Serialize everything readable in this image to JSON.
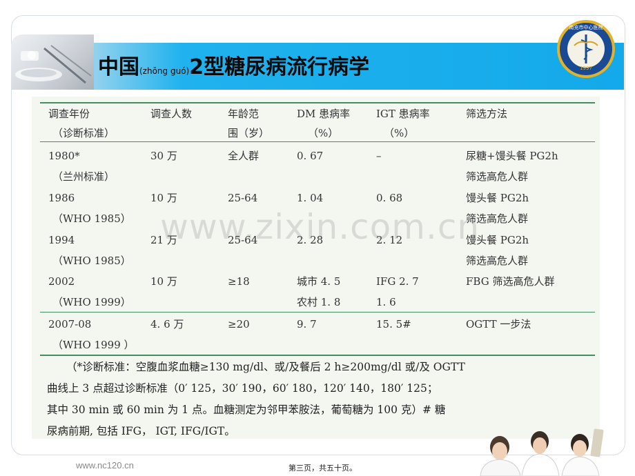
{
  "slide": {
    "title_main": "中国",
    "title_pinyin": "(zhōng guó)",
    "title_rest": "2型糖尿病流行病学"
  },
  "table": {
    "headers": [
      [
        "调查年份",
        "（诊断标准）"
      ],
      [
        "调查人数"
      ],
      [
        "年龄范",
        "围（岁）"
      ],
      [
        "DM 患病率",
        "（%）"
      ],
      [
        "IGT 患病率",
        "（%）"
      ],
      [
        "筛选方法"
      ]
    ],
    "rows": [
      {
        "year": [
          "1980*",
          "（兰州标准）"
        ],
        "people": "30 万",
        "age": "全人群",
        "dm": [
          "0. 67"
        ],
        "igt": [
          "–"
        ],
        "method": [
          "尿糖+馒头餐 PG2h",
          "筛选高危人群"
        ]
      },
      {
        "year": [
          "1986",
          "（WHO 1985）"
        ],
        "people": "10 万",
        "age": "25-64",
        "dm": [
          "1. 04"
        ],
        "igt": [
          "0. 68"
        ],
        "method": [
          "馒头餐 PG2h",
          "筛选高危人群"
        ]
      },
      {
        "year": [
          "1994",
          "（WHO 1985）"
        ],
        "people": "21 万",
        "age": "25-64",
        "dm": [
          "2. 28"
        ],
        "igt": [
          "2. 12"
        ],
        "method": [
          "馒头餐 PG2h",
          "筛选高危人群"
        ]
      },
      {
        "year": [
          "2002",
          "（WHO 1999）"
        ],
        "people": "10 万",
        "age": "≥18",
        "dm": [
          "城市 4. 5",
          "农村 1. 8"
        ],
        "igt": [
          "IFG  2. 7",
          "1. 6"
        ],
        "method": [
          "FBG 筛选高危人群"
        ]
      },
      {
        "year": [
          "2007-08",
          "（WHO 1999 ）"
        ],
        "people": "4. 6  万",
        "age": "≥20",
        "dm": [
          "9. 7"
        ],
        "igt": [
          "15. 5#"
        ],
        "method": [
          "OGTT  一步法"
        ]
      }
    ],
    "note_lines": [
      "（*诊断标准：空腹血浆血糖≥130 mg/dl、或/及餐后 2 h≥200mg/dl 或/及 OGTT",
      "曲线上 3 点超过诊断标准（0′ 125，30′ 190，60′ 180，120′ 140，180′ 125；",
      "其中 30 min 或 60 min 为 1 点。血糖测定为邻甲苯胺法，葡萄糖为 100 克）# 糖",
      "尿病前期, 包括 IFG， IGT, IFG/IGT。"
    ]
  },
  "watermark": "www.zixin.com.cn",
  "footer": {
    "url": "www.nc120.cn",
    "page": "第三页，共五十页。"
  },
  "seal": {
    "year": "1937",
    "ring_text": "NANCHONG CENTRAL HOSPITAL",
    "top_text": "南充市中心医院"
  },
  "colors": {
    "title_band": "#14a9ea",
    "table_rule": "#3f8f5f",
    "seal_blue": "#1b4a94",
    "seal_gold": "#e2b227"
  }
}
